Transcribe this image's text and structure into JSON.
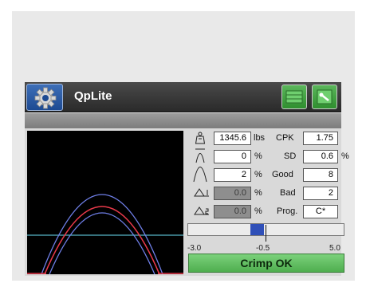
{
  "app": {
    "title": "QpLite"
  },
  "icons": {
    "settings": "gear-icon",
    "grid": "grid-icon",
    "tools": "tools-icon",
    "weight": "weight-icon",
    "peak": "peak-icon",
    "curve": "curve-icon",
    "delta1": "delta-1-icon",
    "delta2": "delta-2-icon"
  },
  "readings": {
    "force": {
      "value": "1345.6",
      "unit": "lbs"
    },
    "r2": {
      "value": "0",
      "unit": "%"
    },
    "r3": {
      "value": "2",
      "unit": "%"
    },
    "r4": {
      "value": "0.0",
      "unit": "%"
    },
    "r5": {
      "value": "0.0",
      "unit": "%"
    }
  },
  "stats": {
    "cpk": {
      "label": "CPK",
      "value": "1.75"
    },
    "sd": {
      "label": "SD",
      "value": "0.6",
      "unit": "%"
    },
    "good": {
      "label": "Good",
      "value": "8"
    },
    "bad": {
      "label": "Bad",
      "value": "2"
    },
    "prog": {
      "label": "Prog.",
      "value": "C*"
    }
  },
  "slider": {
    "min_label": "-3.0",
    "mid_label": "-0.5",
    "max_label": "5.0",
    "marker_value": -0.5
  },
  "status": {
    "text": "Crimp OK",
    "color": "#5cbf5c"
  },
  "colors": {
    "accent_blue": "#1d4a92",
    "curve_red": "#e8394a",
    "curve_blue": "#6f7fe8",
    "baseline": "#57b5c6"
  }
}
